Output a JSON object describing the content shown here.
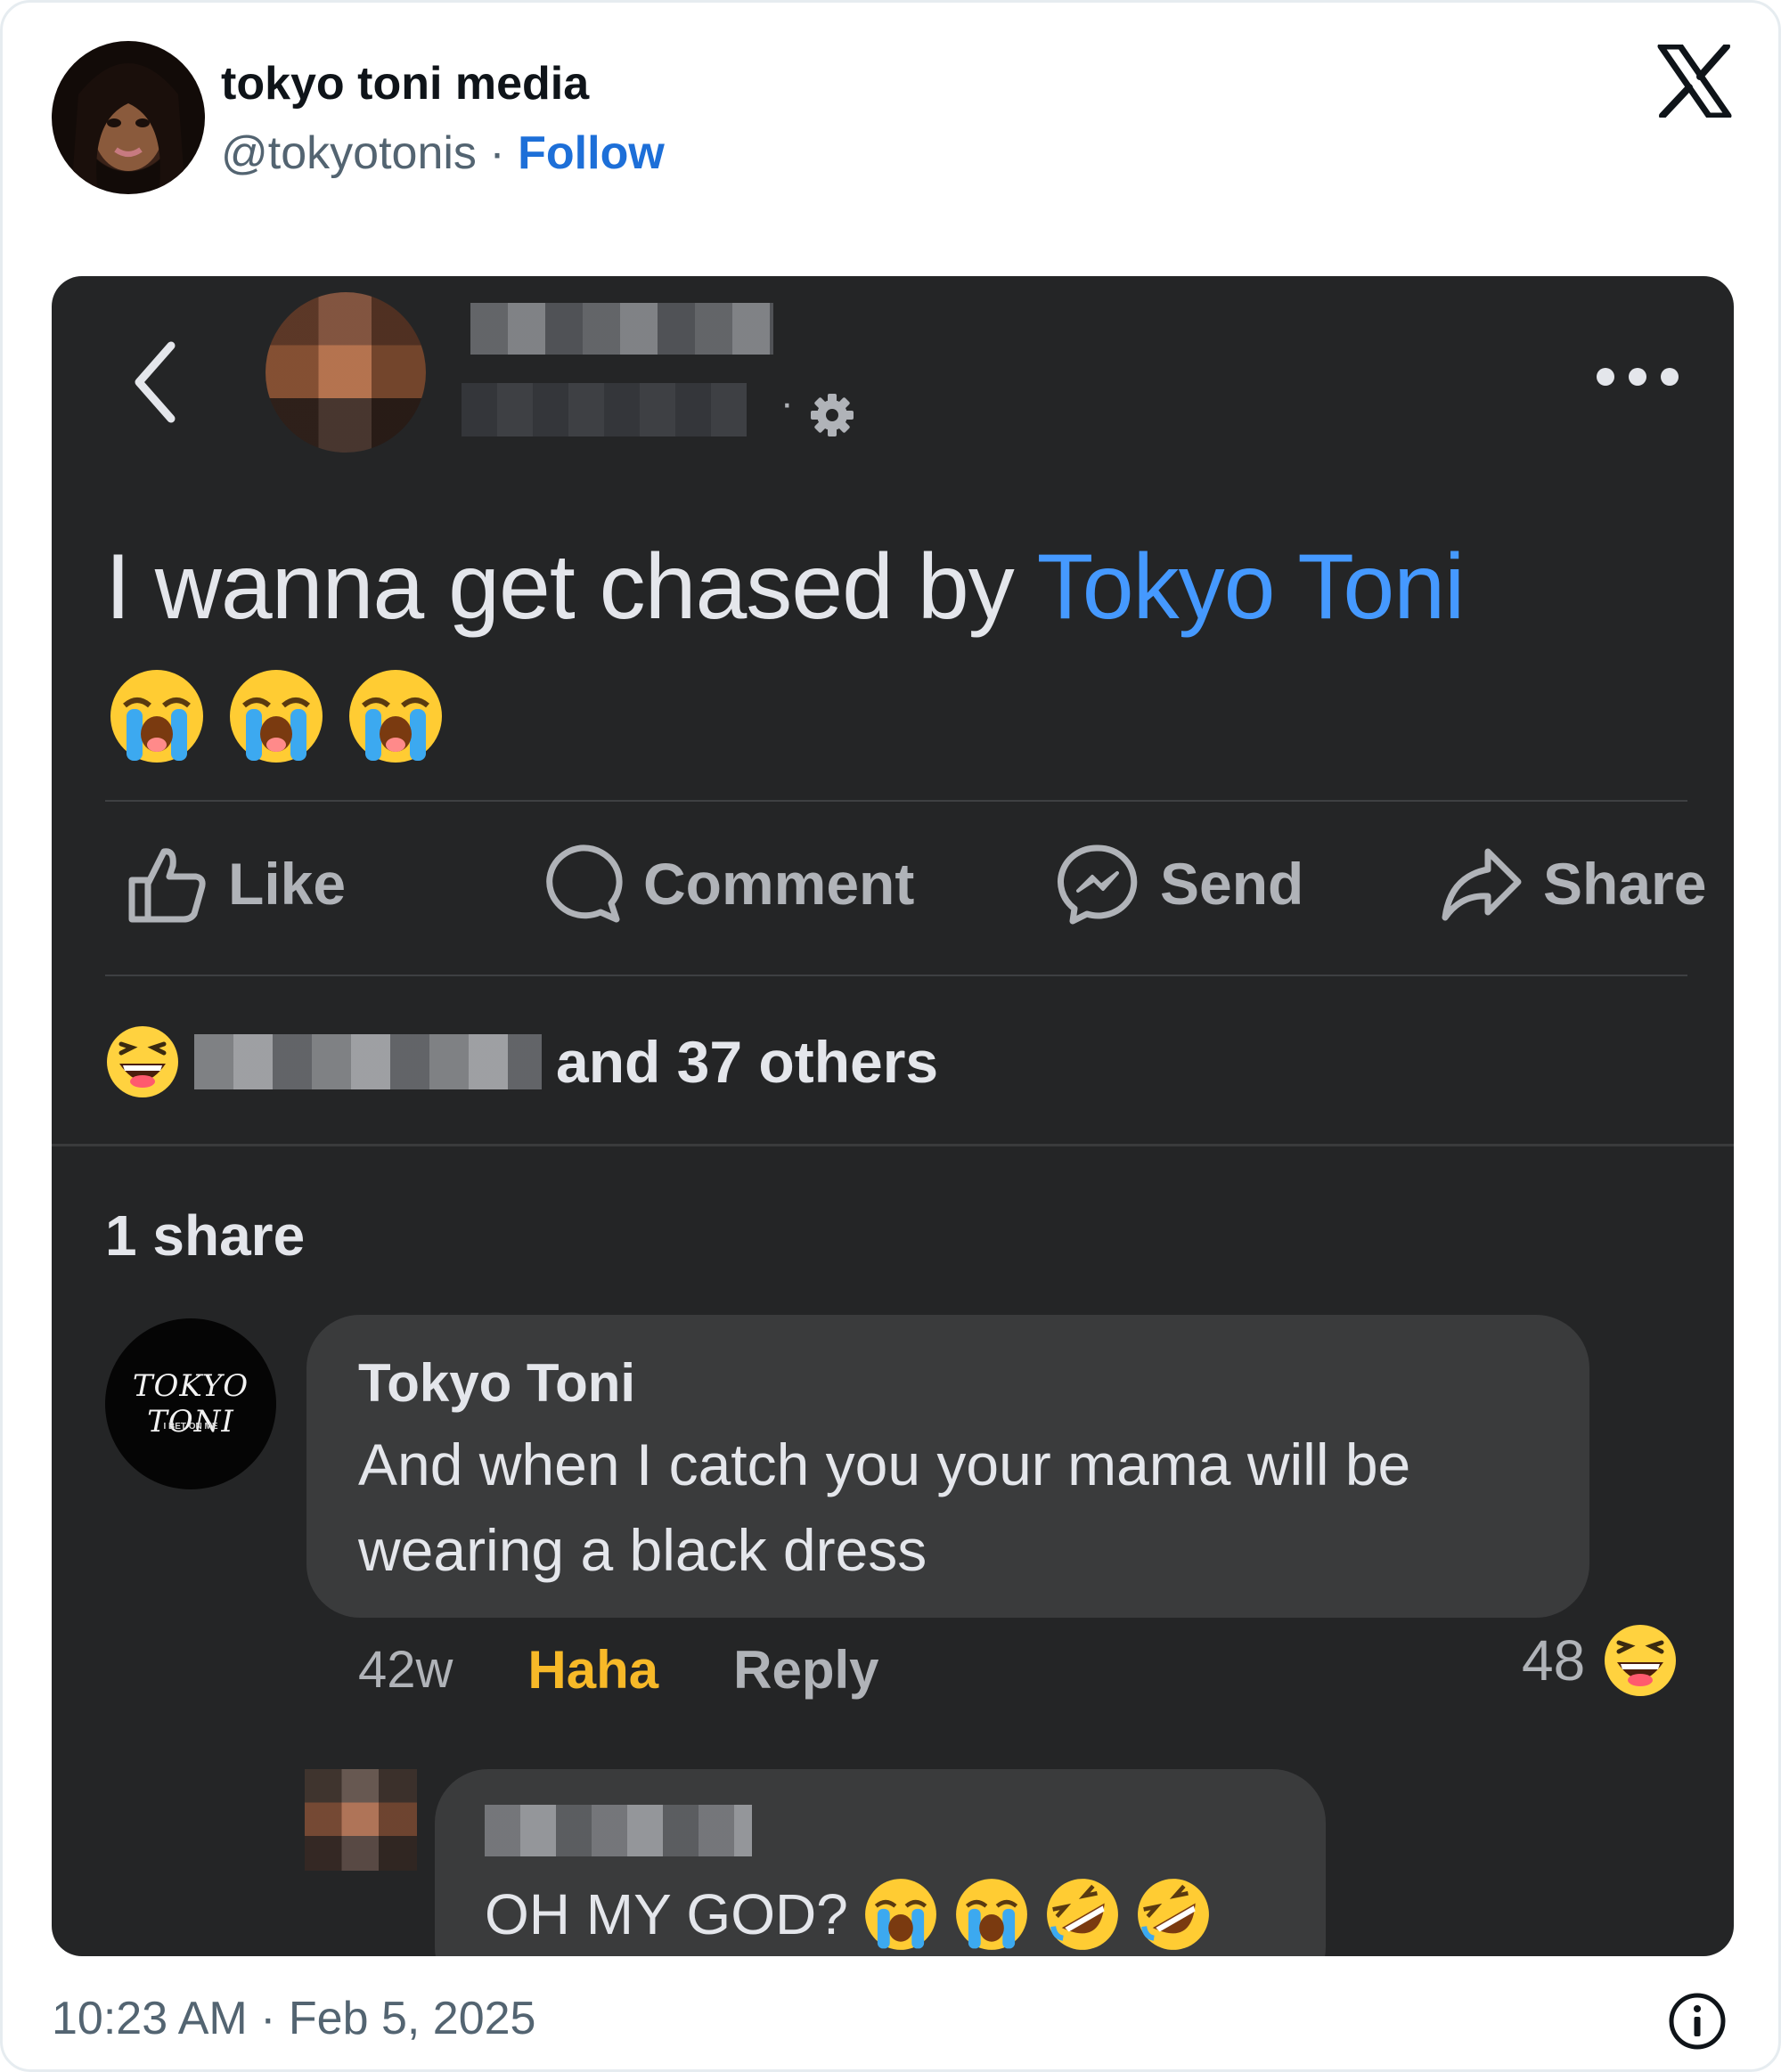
{
  "tweet": {
    "display_name": "tokyo toni media",
    "handle": "@tokyotonis",
    "separator": "·",
    "follow_label": "Follow",
    "timestamp": "10:23 AM · Feb 5, 2025"
  },
  "post": {
    "text_before": "I wanna get chased by ",
    "mention": "Tokyo Toni",
    "emoji_count": 3,
    "actions": [
      {
        "label": "Like",
        "icon": "like-icon"
      },
      {
        "label": "Comment",
        "icon": "comment-icon"
      },
      {
        "label": "Send",
        "icon": "messenger-icon"
      },
      {
        "label": "Share",
        "icon": "share-icon"
      }
    ],
    "reaction_summary": "and 37 others",
    "shares": "1 share"
  },
  "comment": {
    "author": "Tokyo Toni",
    "avatar_logo": "TOKYO TONI",
    "avatar_tagline": "I BET ON ME",
    "text": "And when I catch you your mama will be wearing a black dress",
    "time": "42w",
    "reaction_label": "Haha",
    "reply_label": "Reply",
    "reaction_count": "48"
  },
  "reply": {
    "text": "OH MY GOD?"
  },
  "colors": {
    "follow": "#1d6fd8",
    "mention": "#4599ff",
    "haha": "#f7b928",
    "card_bg": "#242526",
    "bubble_bg": "#3a3b3c"
  }
}
